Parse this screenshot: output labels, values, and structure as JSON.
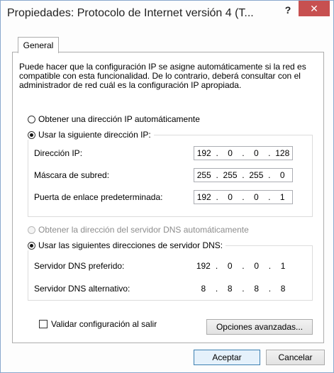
{
  "window": {
    "title": "Propiedades: Protocolo de Internet versión 4 (T...",
    "help_label": "?",
    "close_label": "✕"
  },
  "tabs": [
    {
      "label": "General"
    }
  ],
  "description": "Puede hacer que la configuración IP se asigne automáticamente si la red es compatible con esta funcionalidad. De lo contrario, deberá consultar con el administrador de red cuál es la configuración IP apropiada.",
  "ip": {
    "auto_option": "Obtener una dirección IP automáticamente",
    "manual_option": "Usar la siguiente dirección IP:",
    "auto_selected": false,
    "manual_selected": true,
    "fields": [
      {
        "label": "Dirección IP:",
        "octets": [
          "192",
          "0",
          "0",
          "128"
        ]
      },
      {
        "label": "Máscara de subred:",
        "octets": [
          "255",
          "255",
          "255",
          "0"
        ]
      },
      {
        "label": "Puerta de enlace predeterminada:",
        "octets": [
          "192",
          "0",
          "0",
          "1"
        ]
      }
    ]
  },
  "dns": {
    "auto_option": "Obtener la dirección del servidor DNS automáticamente",
    "manual_option": "Usar las siguientes direcciones de servidor DNS:",
    "auto_selected": false,
    "manual_selected": true,
    "fields": [
      {
        "label": "Servidor DNS preferido:",
        "octets": [
          "192",
          "0",
          "0",
          "1"
        ]
      },
      {
        "label": "Servidor DNS alternativo:",
        "octets": [
          "8",
          "8",
          "8",
          "8"
        ]
      }
    ]
  },
  "validate_label": "Validar configuración al salir",
  "validate_checked": false,
  "advanced_button": "Opciones avanzadas...",
  "ok_button": "Aceptar",
  "cancel_button": "Cancelar",
  "colors": {
    "close_button": "#c75050",
    "window_border": "#8aa8cc"
  }
}
